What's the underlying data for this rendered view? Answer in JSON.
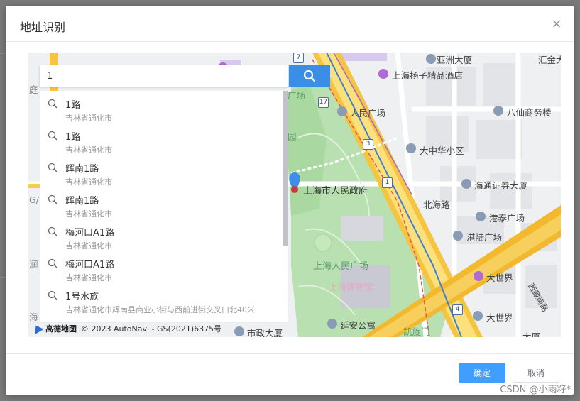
{
  "dialog": {
    "title": "地址识别",
    "close_glyph": "×"
  },
  "search": {
    "value": "1",
    "button_icon": "search-icon"
  },
  "suggestions": [
    {
      "name": "1路",
      "address": "吉林省通化市"
    },
    {
      "name": "1路",
      "address": "吉林省通化市"
    },
    {
      "name": "辉南1路",
      "address": "吉林省通化市"
    },
    {
      "name": "辉南1路",
      "address": "吉林省通化市"
    },
    {
      "name": "梅河口A1路",
      "address": "吉林省通化市"
    },
    {
      "name": "梅河口A1路",
      "address": "吉林省通化市"
    },
    {
      "name": "1号水族",
      "address": "吉林省通化市辉南县商业小街与西前进街交叉口北40米"
    }
  ],
  "map": {
    "labels": {
      "asia": "亚洲大厦",
      "jinjiang": "汇金大",
      "hotel": "上海扬子精品酒店",
      "square_top": "广场",
      "peoples_square": "人民广场",
      "baxian": "八仙商务楼",
      "dazhonghua": "大中华小区",
      "haitong": "海通证券大厦",
      "gov": "上海市人民政府",
      "beihai": "北海路",
      "gangtai": "港泰广场",
      "ganglu": "港陆广场",
      "park": "上海人民广场",
      "museum": "上海博物馆",
      "dashijie1": "大世界",
      "dashijie2": "大世界",
      "xizang": "西藏南路",
      "yanan": "延安公寓",
      "kaixuan": "凯旋门",
      "shizheng": "市政大厦",
      "left1": "庭",
      "left2": "G/",
      "left3": "润",
      "left4": "海",
      "bottom_right": "大厦",
      "yuan": "园"
    },
    "shields": [
      "7",
      "17",
      "3",
      "1",
      "4"
    ],
    "attribution_logo": "高德地图",
    "attribution_text": "© 2023 AutoNavi - GS(2021)6375号"
  },
  "footer": {
    "confirm_label": "确定",
    "cancel_label": "取消"
  },
  "watermark": "CSDN @小雨籽*",
  "colors": {
    "primary": "#409eff",
    "search_button": "#3a8ee6",
    "park_green": "#b8e0b0",
    "highway_yellow": "#f5c542",
    "marker_blue": "#3d8ee8"
  }
}
